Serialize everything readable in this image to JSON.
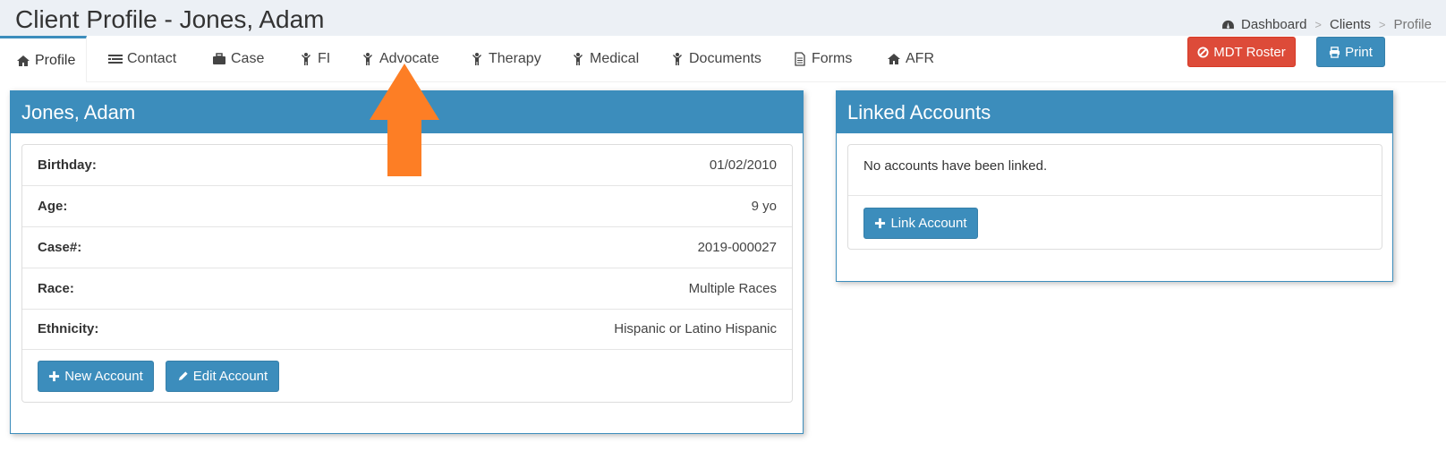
{
  "header": {
    "title": "Client Profile - Jones, Adam",
    "breadcrumb": [
      {
        "label": "Dashboard",
        "icon": "dashboard-icon"
      },
      {
        "label": "Clients"
      },
      {
        "label": "Profile"
      }
    ],
    "separator": ">"
  },
  "tabs": [
    {
      "label": "Profile",
      "icon": "home-icon",
      "active": true
    },
    {
      "label": "Contact",
      "icon": "list-icon"
    },
    {
      "label": "Case",
      "icon": "briefcase-icon"
    },
    {
      "label": "FI",
      "icon": "child-icon"
    },
    {
      "label": "Advocate",
      "icon": "child-icon"
    },
    {
      "label": "Therapy",
      "icon": "child-icon"
    },
    {
      "label": "Medical",
      "icon": "child-icon"
    },
    {
      "label": "Documents",
      "icon": "child-icon"
    },
    {
      "label": "Forms",
      "icon": "file-icon"
    },
    {
      "label": "AFR",
      "icon": "home-icon"
    }
  ],
  "actions": {
    "mdt_roster": "MDT Roster",
    "print": "Print"
  },
  "client_panel": {
    "title": "Jones, Adam",
    "fields": [
      {
        "label": "Birthday:",
        "value": "01/02/2010"
      },
      {
        "label": "Age:",
        "value": "9 yo"
      },
      {
        "label": "Case#:",
        "value": "2019-000027"
      },
      {
        "label": "Race:",
        "value": "Multiple Races"
      },
      {
        "label": "Ethnicity:",
        "value": "Hispanic or Latino Hispanic"
      }
    ],
    "new_account": "New Account",
    "edit_account": "Edit Account"
  },
  "linked_panel": {
    "title": "Linked Accounts",
    "empty_text": "No accounts have been linked.",
    "link_account": "Link Account"
  },
  "colors": {
    "primary": "#3c8dbc",
    "danger": "#dd4b39",
    "annotation_arrow": "#fd7e25"
  }
}
